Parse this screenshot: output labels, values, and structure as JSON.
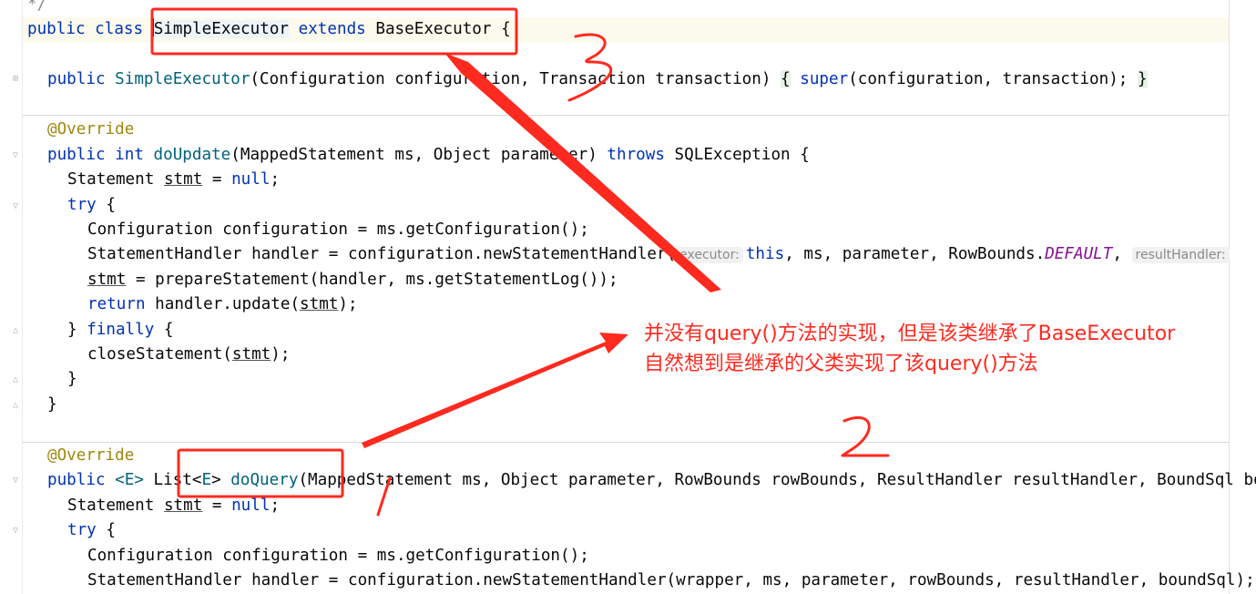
{
  "code": {
    "line0": "*/",
    "line1": {
      "kw1": "public",
      "kw2": "class",
      "cls": "SimpleExecutor",
      "kw3": "extends",
      "base": "BaseExecutor",
      "brace": "{"
    },
    "line2": {
      "kw": "public",
      "fn": "SimpleExecutor",
      "params": "(Configuration configuration, Transaction transaction) ",
      "open": "{",
      "sp": " ",
      "kw2": "super",
      "args": "(configuration, transaction); ",
      "close": "}"
    },
    "line3": "@Override",
    "line4": {
      "kw1": "public",
      "kw2": "int",
      "fn": "doUpdate",
      "params": "(MappedStatement ms, Object parameter) ",
      "kw3": "throws",
      "rest": " SQLException {"
    },
    "line5": {
      "a": "Statement ",
      "var": "stmt",
      "b": " = ",
      "kw": "null",
      "c": ";"
    },
    "line6": {
      "kw": "try",
      "rest": " {"
    },
    "line7": "Configuration configuration = ms.getConfiguration();",
    "line8": {
      "a": "StatementHandler handler = configuration.newStatementHandler(",
      "hint1": "executor:",
      "kw": "this",
      "b": ", ms, parameter, RowBounds.",
      "const": "DEFAULT",
      "c": ", ",
      "hint2": "resultHandler:"
    },
    "line9": {
      "var": "stmt",
      "a": " = prepareStatement(handler, ms.getStatementLog());"
    },
    "line10": {
      "kw": "return",
      "a": " handler.update(",
      "var": "stmt",
      "b": ");"
    },
    "line11": {
      "a": "} ",
      "kw": "finally",
      "b": " {"
    },
    "line12": {
      "a": "closeStatement(",
      "var": "stmt",
      "b": ");"
    },
    "line13": "}",
    "line14": "}",
    "line15": "@Override",
    "line16": {
      "kw1": "public",
      "gen": " <E> ",
      "a": "List<",
      "gen2": "E",
      "b": "> ",
      "fn": "doQuery",
      "params": "(MappedStatement ms, Object parameter, RowBounds rowBounds, ResultHandler resultHandler, BoundSql boundSql) throws SQLException {"
    },
    "line17": {
      "a": "Statement ",
      "var": "stmt",
      "b": " = ",
      "kw": "null",
      "c": ";"
    },
    "line18": {
      "kw": "try",
      "rest": " {"
    },
    "line19": "Configuration configuration = ms.getConfiguration();",
    "line20": "StatementHandler handler = configuration.newStatementHandler(wrapper, ms, parameter, rowBounds, resultHandler, boundSql);"
  },
  "annotation": {
    "note_line1": "并没有query()方法的实现，但是该类继承了BaseExecutor",
    "note_line2": "自然想到是继承的父类实现了该query()方法",
    "color": "#ff2a1f"
  }
}
